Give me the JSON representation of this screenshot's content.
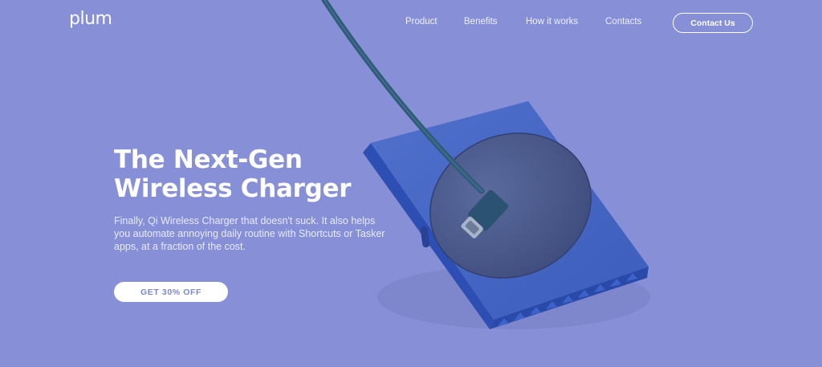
{
  "header": {
    "logo_text": "plum",
    "nav": {
      "product": "Product",
      "benefits": "Benefits",
      "how_it_works": "How it works",
      "contacts": "Contacts"
    },
    "contact_button": "Contact Us"
  },
  "hero": {
    "title_line1": "The Next-Gen",
    "title_line2": "Wireless Charger",
    "subtitle": "Finally, Qi Wireless Charger that doesn't suck. It also helps you automate annoying daily routine with Shortcuts or Tasker apps, at a fraction of the cost.",
    "cta_label": "GET 30% OFF"
  },
  "colors": {
    "background": "#8790d6",
    "charger_base": "#3b5bbf",
    "charger_pad": "#4a5a8e",
    "cable": "#2f5a78",
    "text": "#ffffff",
    "cta_text": "#7e87c8"
  },
  "icons": {
    "product_image": "wireless-charger-with-usb-c-cable"
  }
}
